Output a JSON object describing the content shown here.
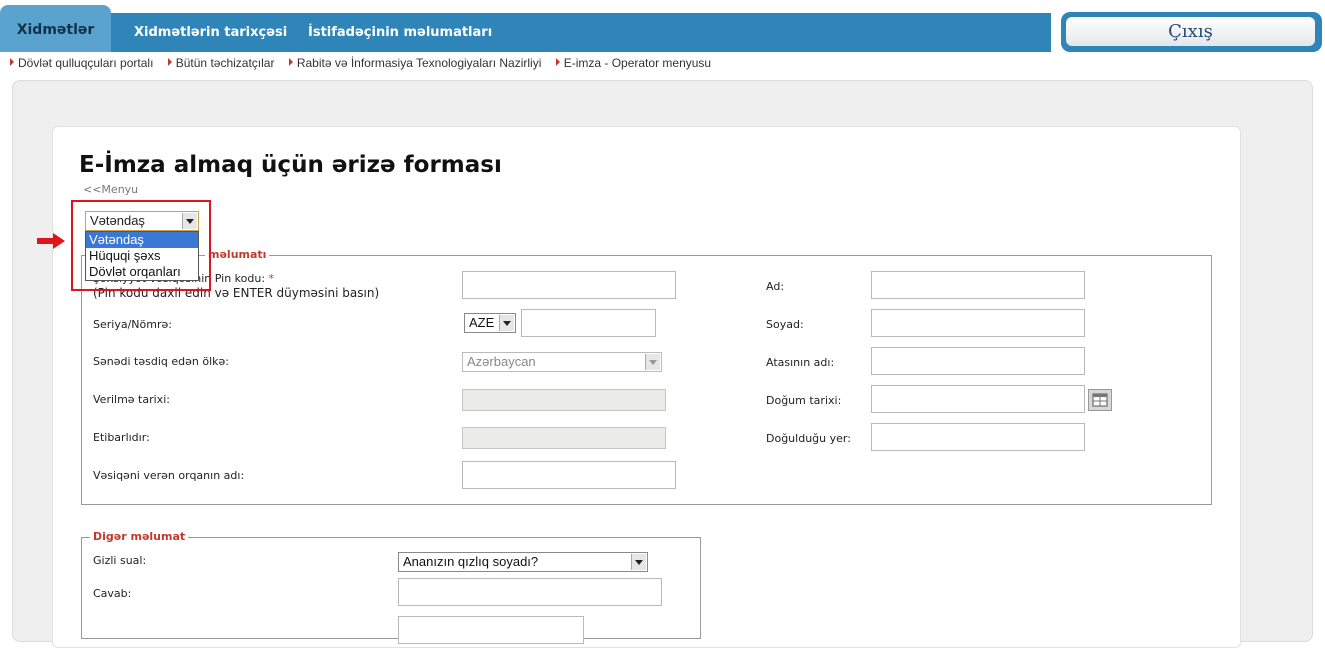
{
  "nav": {
    "tabs": [
      "Xidmətlər",
      "Xidmətlərin tarixçəsi",
      "İstifadəçinin məlumatları"
    ],
    "logout": "Çıxış"
  },
  "breadcrumbs": [
    "Dövlət qulluqçuları portalı",
    "Bütün təchizatçılar",
    "Rabitə və İnformasiya Texnologiyaları Nazirliyi",
    "E-imza - Operator menyusu"
  ],
  "page": {
    "title": "E-İmza almaq üçün ərizə forması",
    "back_link": "<<Menyu"
  },
  "type_select": {
    "value": "Vətəndaş",
    "options": [
      "Vətəndaş",
      "Hüquqi şəxs",
      "Dövlət orqanları"
    ]
  },
  "personal": {
    "legend": "məlumatı",
    "pin_label": "Şəxsiyyət vəsiqəsinin Pin kodu:",
    "pin_hint": "(Pin kodu daxil edin və ENTER düyməsini basın)",
    "serial_label": "Seriya/Nömrə:",
    "serial_prefix": "AZE",
    "country_label": "Sənədi təsdiq edən ölkə:",
    "country_value": "Azərbaycan",
    "issue_date_label": "Verilmə tarixi:",
    "valid_label": "Etibarlıdır:",
    "issuer_label": "Vəsiqəni verən orqanın adı:",
    "name_label": "Ad:",
    "surname_label": "Soyad:",
    "father_label": "Atasının adı:",
    "birth_date_label": "Doğum tarixi:",
    "birth_place_label": "Doğulduğu yer:"
  },
  "other": {
    "legend": "Digər məlumat",
    "secret_label": "Gizli sual:",
    "secret_value": "Ananızın qızlıq soyadı?",
    "answer_label": "Cavab:"
  },
  "colors": {
    "nav": "#2f85b8",
    "accent_red": "#c0392b",
    "highlight": "#e0141b",
    "selected_option": "#3b78d6"
  }
}
